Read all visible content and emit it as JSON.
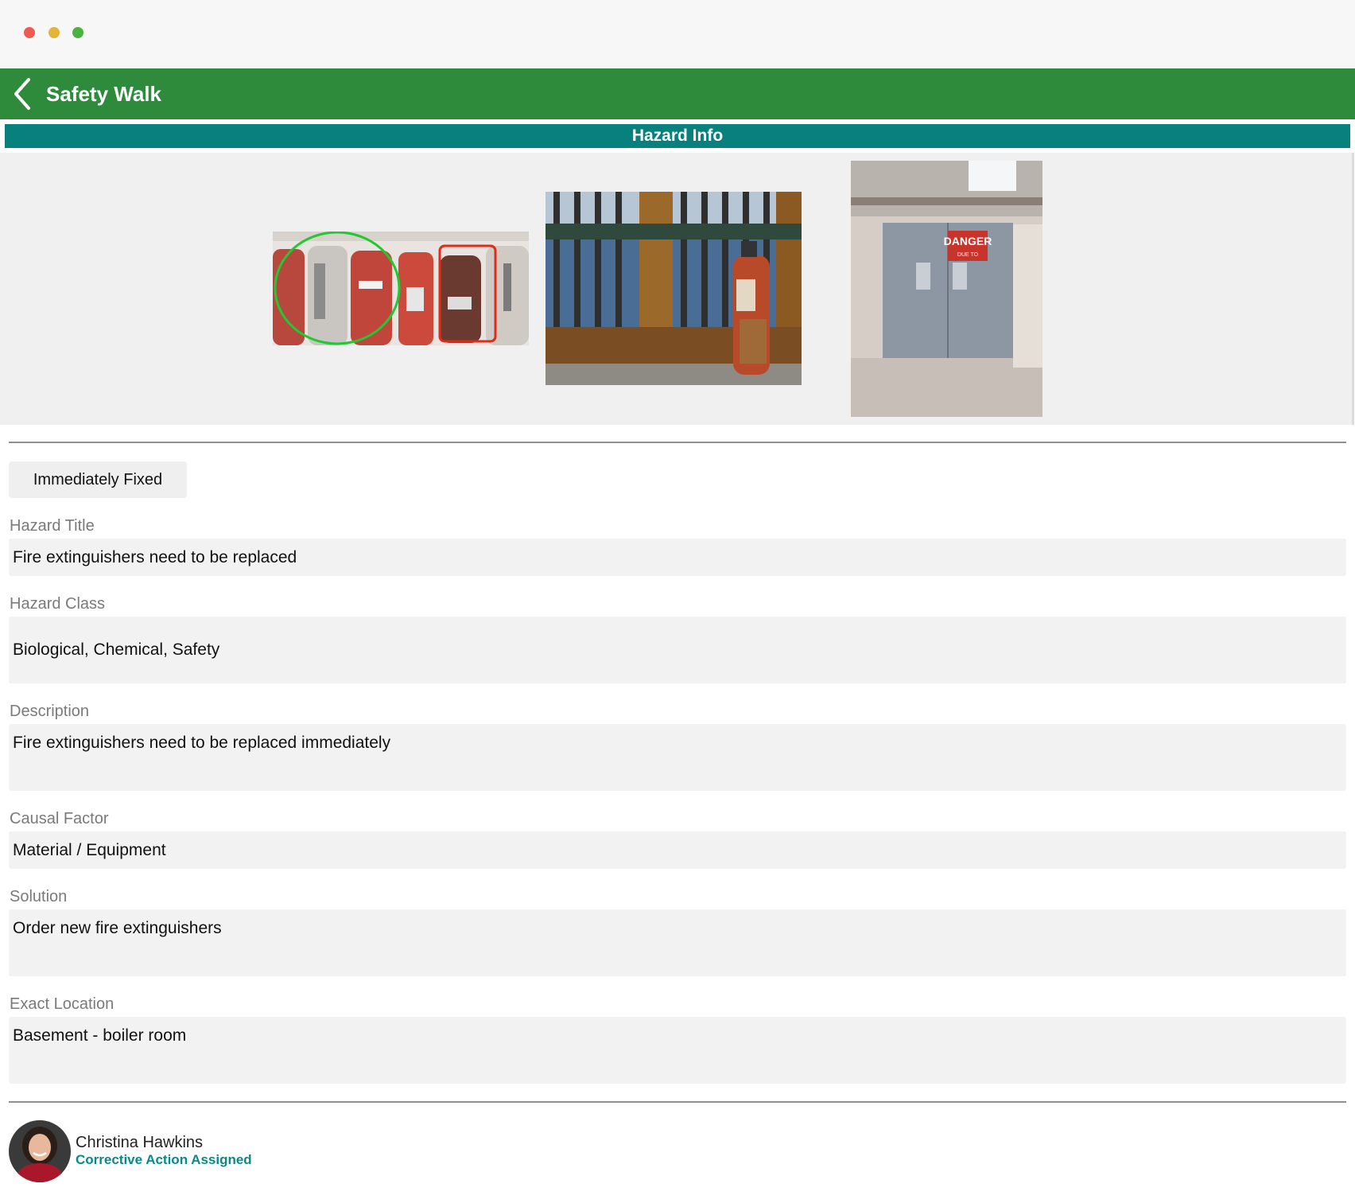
{
  "window": {
    "controls": [
      "close",
      "minimize",
      "maximize"
    ]
  },
  "header": {
    "title": "Safety Walk",
    "back_icon": "chevron-left-icon",
    "color": "#2e8b3b"
  },
  "section": {
    "title": "Hazard Info",
    "color": "#08807e"
  },
  "gallery": {
    "photos": [
      "fire-extinguishers-annotated",
      "rusty-fire-extinguisher",
      "danger-door"
    ]
  },
  "status": {
    "label": "Immediately Fixed"
  },
  "fields": {
    "hazard_title": {
      "label": "Hazard Title",
      "value": "Fire extinguishers need to be replaced"
    },
    "hazard_class": {
      "label": "Hazard Class",
      "value": "Biological, Chemical, Safety"
    },
    "description": {
      "label": "Description",
      "value": "Fire extinguishers need to be replaced immediately"
    },
    "causal_factor": {
      "label": "Causal Factor",
      "value": "Material / Equipment"
    },
    "solution": {
      "label": "Solution",
      "value": "Order new fire extinguishers"
    },
    "exact_location": {
      "label": "Exact Location",
      "value": "Basement - boiler room"
    }
  },
  "assignee": {
    "name": "Christina Hawkins",
    "status": "Corrective Action Assigned",
    "status_color": "#0a8a86"
  },
  "photo_text": {
    "danger_sign": "DANGER",
    "danger_sub": "DUE TO"
  }
}
